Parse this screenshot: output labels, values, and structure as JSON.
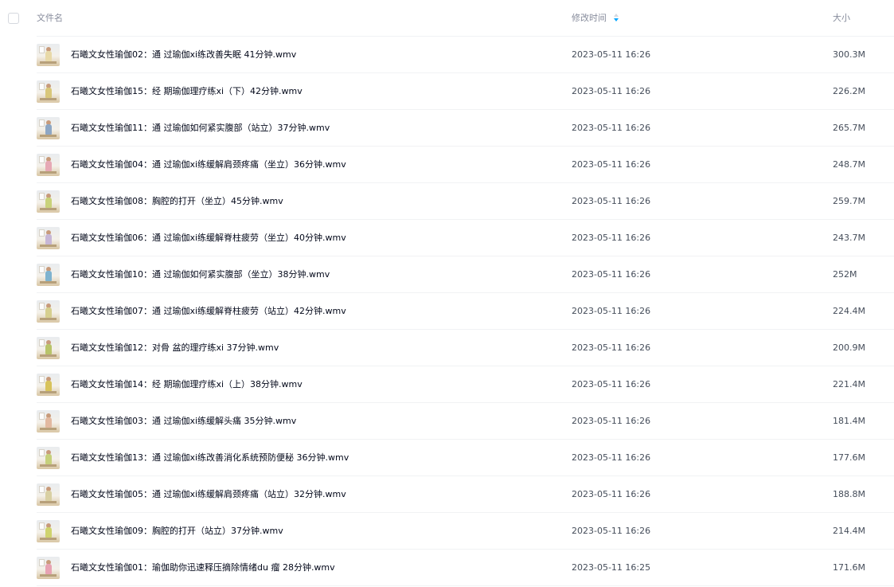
{
  "header": {
    "name_label": "文件名",
    "time_label": "修改时间",
    "size_label": "大小"
  },
  "colors": {
    "accent": "#06a7ff",
    "text_primary": "#03081a",
    "text_secondary": "#454d5a",
    "header_text": "#878c9c",
    "divider": "#f1f2f4"
  },
  "files": [
    {
      "name": "石曦文女性瑜伽02：通 过瑜伽xi练改善失眠 41分钟.wmv",
      "time": "2023-05-11 16:26",
      "size": "300.3M",
      "thumb_icon": "video-thumbnail-icon",
      "figure_color": "#e8d9a8"
    },
    {
      "name": "石曦文女性瑜伽15：经 期瑜伽理疗练xi（下）42分钟.wmv",
      "time": "2023-05-11 16:26",
      "size": "226.2M",
      "thumb_icon": "video-thumbnail-icon",
      "figure_color": "#d9c77a"
    },
    {
      "name": "石曦文女性瑜伽11：通 过瑜伽如何紧实腹部（站立）37分钟.wmv",
      "time": "2023-05-11 16:26",
      "size": "265.7M",
      "thumb_icon": "video-thumbnail-icon",
      "figure_color": "#8ea7c4"
    },
    {
      "name": "石曦文女性瑜伽04：通 过瑜伽xi练缓解肩颈疼痛（坐立）36分钟.wmv",
      "time": "2023-05-11 16:26",
      "size": "248.7M",
      "thumb_icon": "video-thumbnail-icon",
      "figure_color": "#e6a9b5"
    },
    {
      "name": "石曦文女性瑜伽08：胸腔的打开（坐立）45分钟.wmv",
      "time": "2023-05-11 16:26",
      "size": "259.7M",
      "thumb_icon": "video-thumbnail-icon",
      "figure_color": "#c9d27a"
    },
    {
      "name": "石曦文女性瑜伽06：通 过瑜伽xi练缓解脊柱疲劳（坐立）40分钟.wmv",
      "time": "2023-05-11 16:26",
      "size": "243.7M",
      "thumb_icon": "video-thumbnail-icon",
      "figure_color": "#c7b7d6"
    },
    {
      "name": "石曦文女性瑜伽10：通 过瑜伽如何紧实腹部（坐立）38分钟.wmv",
      "time": "2023-05-11 16:26",
      "size": "252M",
      "thumb_icon": "video-thumbnail-icon",
      "figure_color": "#7fb3cf"
    },
    {
      "name": "石曦文女性瑜伽07：通 过瑜伽xi练缓解脊柱疲劳（站立）42分钟.wmv",
      "time": "2023-05-11 16:26",
      "size": "224.4M",
      "thumb_icon": "video-thumbnail-icon",
      "figure_color": "#d6cf8f"
    },
    {
      "name": "石曦文女性瑜伽12：对骨 盆的理疗练xi 37分钟.wmv",
      "time": "2023-05-11 16:26",
      "size": "200.9M",
      "thumb_icon": "video-thumbnail-icon",
      "figure_color": "#b9c46a"
    },
    {
      "name": "石曦文女性瑜伽14：经 期瑜伽理疗练xi（上）38分钟.wmv",
      "time": "2023-05-11 16:26",
      "size": "221.4M",
      "thumb_icon": "video-thumbnail-icon",
      "figure_color": "#d8c35c"
    },
    {
      "name": "石曦文女性瑜伽03：通 过瑜伽xi练缓解头痛 35分钟.wmv",
      "time": "2023-05-11 16:26",
      "size": "181.4M",
      "thumb_icon": "video-thumbnail-icon",
      "figure_color": "#e2b9a0"
    },
    {
      "name": "石曦文女性瑜伽13：通 过瑜伽xi练改善消化系统预防便秘 36分钟.wmv",
      "time": "2023-05-11 16:26",
      "size": "177.6M",
      "thumb_icon": "video-thumbnail-icon",
      "figure_color": "#c6d07c"
    },
    {
      "name": "石曦文女性瑜伽05：通 过瑜伽xi练缓解肩颈疼痛（站立）32分钟.wmv",
      "time": "2023-05-11 16:26",
      "size": "188.8M",
      "thumb_icon": "video-thumbnail-icon",
      "figure_color": "#d9d0a3"
    },
    {
      "name": "石曦文女性瑜伽09：胸腔的打开（站立）37分钟.wmv",
      "time": "2023-05-11 16:26",
      "size": "214.4M",
      "thumb_icon": "video-thumbnail-icon",
      "figure_color": "#cfd36e"
    },
    {
      "name": "石曦文女性瑜伽01：瑜伽助你迅速释压摘除情绪du 瘤 28分钟.wmv",
      "time": "2023-05-11 16:25",
      "size": "171.6M",
      "thumb_icon": "video-thumbnail-icon",
      "figure_color": "#e7a3b3"
    }
  ]
}
